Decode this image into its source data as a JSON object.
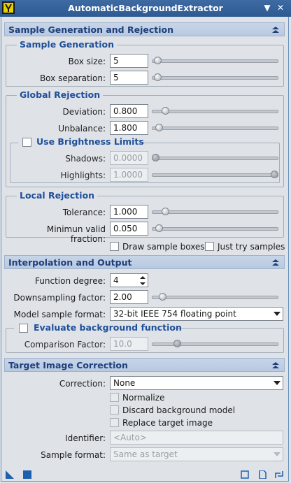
{
  "window": {
    "title": "AutomaticBackgroundExtractor",
    "pin_glyph": "▼",
    "close_glyph": "✕"
  },
  "sample_gen_section": {
    "title": "Sample Generation and Rejection",
    "sample_generation": {
      "title": "Sample Generation",
      "box_size": {
        "label": "Box size:",
        "value": "5",
        "slider_fraction": 0.02
      },
      "box_separation": {
        "label": "Box separation:",
        "value": "5",
        "slider_fraction": 0.02
      }
    },
    "global_rejection": {
      "title": "Global Rejection",
      "deviation": {
        "label": "Deviation:",
        "value": "0.800",
        "slider_fraction": 0.08
      },
      "unbalance": {
        "label": "Unbalance:",
        "value": "1.800",
        "slider_fraction": 0.03
      },
      "brightness_limits": {
        "title": "Use Brightness Limits",
        "checked": false,
        "shadows": {
          "label": "Shadows:",
          "value": "0.0000",
          "slider_fraction": 0.0
        },
        "highlights": {
          "label": "Highlights:",
          "value": "1.0000",
          "slider_fraction": 1.0
        }
      }
    },
    "local_rejection": {
      "title": "Local Rejection",
      "tolerance": {
        "label": "Tolerance:",
        "value": "1.000",
        "slider_fraction": 0.08
      },
      "min_valid_fraction": {
        "label": "Minimun valid fraction:",
        "value": "0.050",
        "slider_fraction": 0.03
      }
    },
    "draw_sample_boxes": {
      "label": "Draw sample boxes",
      "checked": false
    },
    "just_try_samples": {
      "label": "Just try samples",
      "checked": false
    }
  },
  "interp_section": {
    "title": "Interpolation and Output",
    "function_degree": {
      "label": "Function degree:",
      "value": "4"
    },
    "downsampling": {
      "label": "Downsampling factor:",
      "value": "2.00",
      "slider_fraction": 0.06
    },
    "model_sample_format": {
      "label": "Model sample format:",
      "value": "32-bit IEEE 754 floating point"
    },
    "evaluate_bg": {
      "title": "Evaluate background function",
      "checked": false,
      "comparison_factor": {
        "label": "Comparison Factor:",
        "value": "10.0",
        "slider_fraction": 0.18
      }
    }
  },
  "target_section": {
    "title": "Target Image Correction",
    "correction": {
      "label": "Correction:",
      "value": "None"
    },
    "normalize": {
      "label": "Normalize",
      "checked": false
    },
    "discard_bg_model": {
      "label": "Discard background model",
      "checked": false
    },
    "replace_target": {
      "label": "Replace target image",
      "checked": false
    },
    "identifier": {
      "label": "Identifier:",
      "placeholder": "<Auto>"
    },
    "sample_format": {
      "label": "Sample format:",
      "value": "Same as target"
    }
  },
  "colors": {
    "accent": "#1f4f9a",
    "title_bar": "#2d5a93",
    "panel_bg": "#dfe3e8"
  }
}
